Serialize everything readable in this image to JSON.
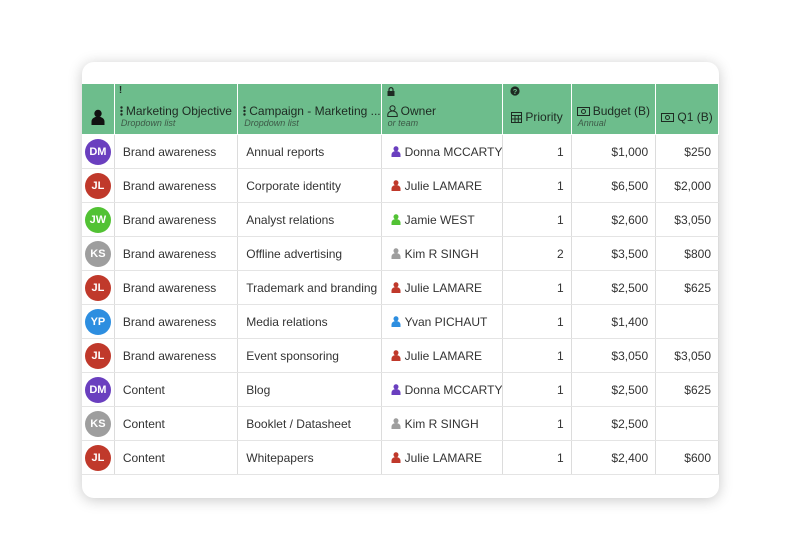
{
  "colors": {
    "header_bg": "#6dbd8c"
  },
  "columns": [
    {
      "key": "avatar",
      "icon": "person-icon"
    },
    {
      "key": "objective",
      "label": "Marketing Objective",
      "sub": "Dropdown list",
      "indicator": "!"
    },
    {
      "key": "campaign",
      "label": "Campaign - Marketing ...",
      "sub": "Dropdown list"
    },
    {
      "key": "owner",
      "label": "Owner",
      "sub": "or team",
      "icon": "lock-icon"
    },
    {
      "key": "priority",
      "label": "Priority",
      "icon": "help-icon"
    },
    {
      "key": "budget",
      "label": "Budget (B)",
      "sub": "Annual"
    },
    {
      "key": "q1",
      "label": "Q1 (B)"
    }
  ],
  "rows": [
    {
      "initials": "DM",
      "avatar_color": "#6a3fbf",
      "objective": "Brand awareness",
      "campaign": "Annual reports",
      "owner": "Donna MCCARTY",
      "priority": "1",
      "budget": "$1,000",
      "q1": "$250"
    },
    {
      "initials": "JL",
      "avatar_color": "#c0392b",
      "objective": "Brand awareness",
      "campaign": "Corporate identity",
      "owner": "Julie LAMARE",
      "priority": "1",
      "budget": "$6,500",
      "q1": "$2,000"
    },
    {
      "initials": "JW",
      "avatar_color": "#52c234",
      "objective": "Brand awareness",
      "campaign": "Analyst relations",
      "owner": "Jamie WEST",
      "priority": "1",
      "budget": "$2,600",
      "q1": "$3,050"
    },
    {
      "initials": "KS",
      "avatar_color": "#9e9e9e",
      "objective": "Brand awareness",
      "campaign": "Offline advertising",
      "owner": "Kim R SINGH",
      "priority": "2",
      "budget": "$3,500",
      "q1": "$800"
    },
    {
      "initials": "JL",
      "avatar_color": "#c0392b",
      "objective": "Brand awareness",
      "campaign": "Trademark and branding",
      "owner": "Julie LAMARE",
      "priority": "1",
      "budget": "$2,500",
      "q1": "$625"
    },
    {
      "initials": "YP",
      "avatar_color": "#2d8ee0",
      "objective": "Brand awareness",
      "campaign": "Media relations",
      "owner": "Yvan PICHAUT",
      "priority": "1",
      "budget": "$1,400",
      "q1": ""
    },
    {
      "initials": "JL",
      "avatar_color": "#c0392b",
      "objective": "Brand awareness",
      "campaign": "Event sponsoring",
      "owner": "Julie LAMARE",
      "priority": "1",
      "budget": "$3,050",
      "q1": "$3,050"
    },
    {
      "initials": "DM",
      "avatar_color": "#6a3fbf",
      "objective": "Content",
      "campaign": "Blog",
      "owner": "Donna MCCARTY",
      "priority": "1",
      "budget": "$2,500",
      "q1": "$625"
    },
    {
      "initials": "KS",
      "avatar_color": "#9e9e9e",
      "objective": "Content",
      "campaign": "Booklet / Datasheet",
      "owner": "Kim R SINGH",
      "priority": "1",
      "budget": "$2,500",
      "q1": ""
    },
    {
      "initials": "JL",
      "avatar_color": "#c0392b",
      "objective": "Content",
      "campaign": "Whitepapers",
      "owner": "Julie LAMARE",
      "priority": "1",
      "budget": "$2,400",
      "q1": "$600"
    }
  ]
}
